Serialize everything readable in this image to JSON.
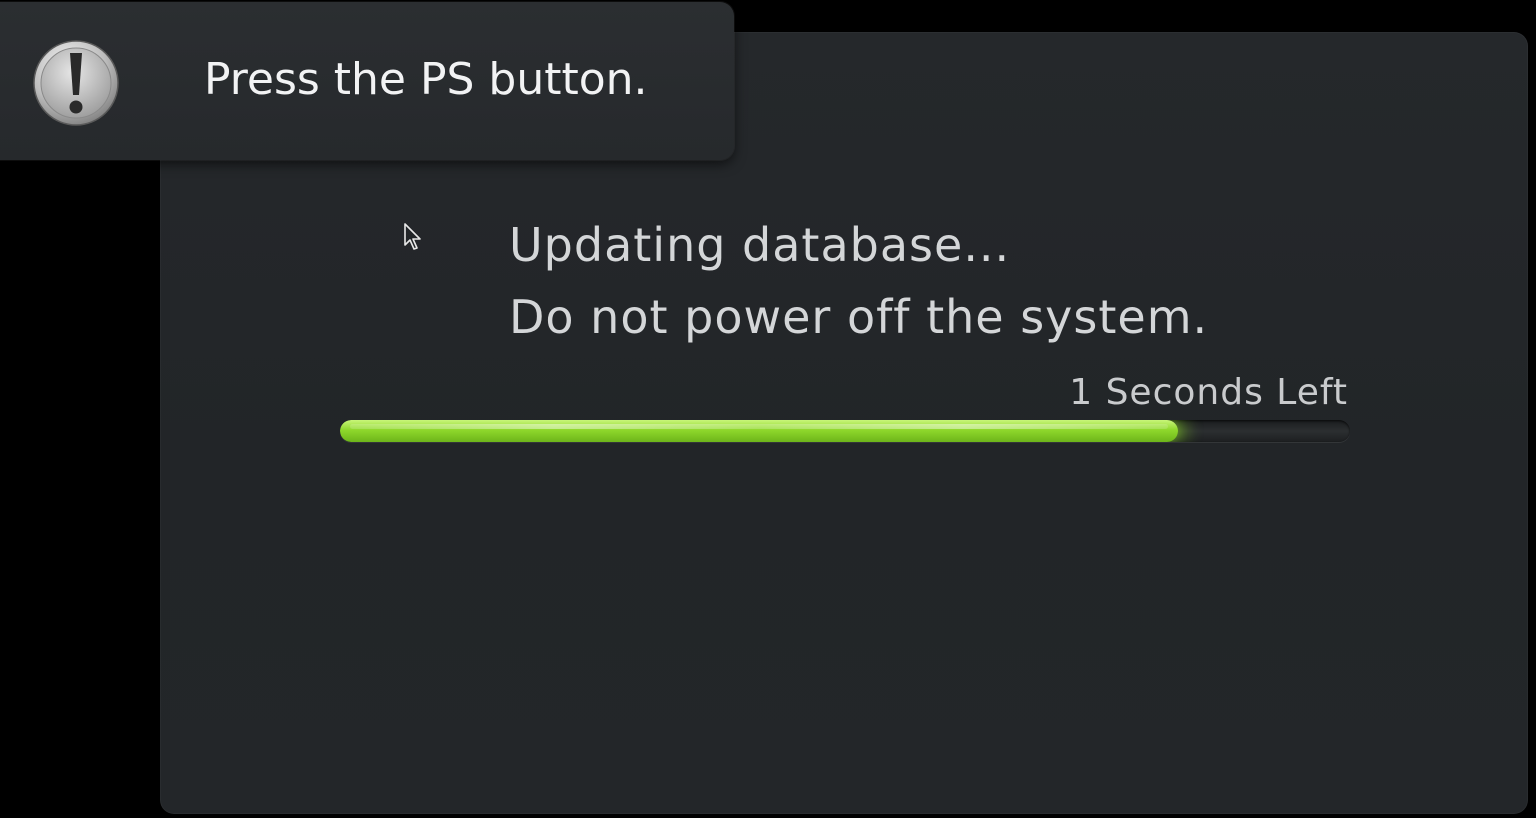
{
  "notification": {
    "icon": "exclamation-icon",
    "text": "Press the PS button."
  },
  "dialog": {
    "message_line1": "Updating database...",
    "message_line2": "Do not power off the system.",
    "time_left": "1 Seconds Left",
    "progress_fraction": 0.83
  },
  "colors": {
    "background": "#000000",
    "panel": "#232629",
    "progress_green": "#8fd82c",
    "text": "#d4d6d8"
  }
}
